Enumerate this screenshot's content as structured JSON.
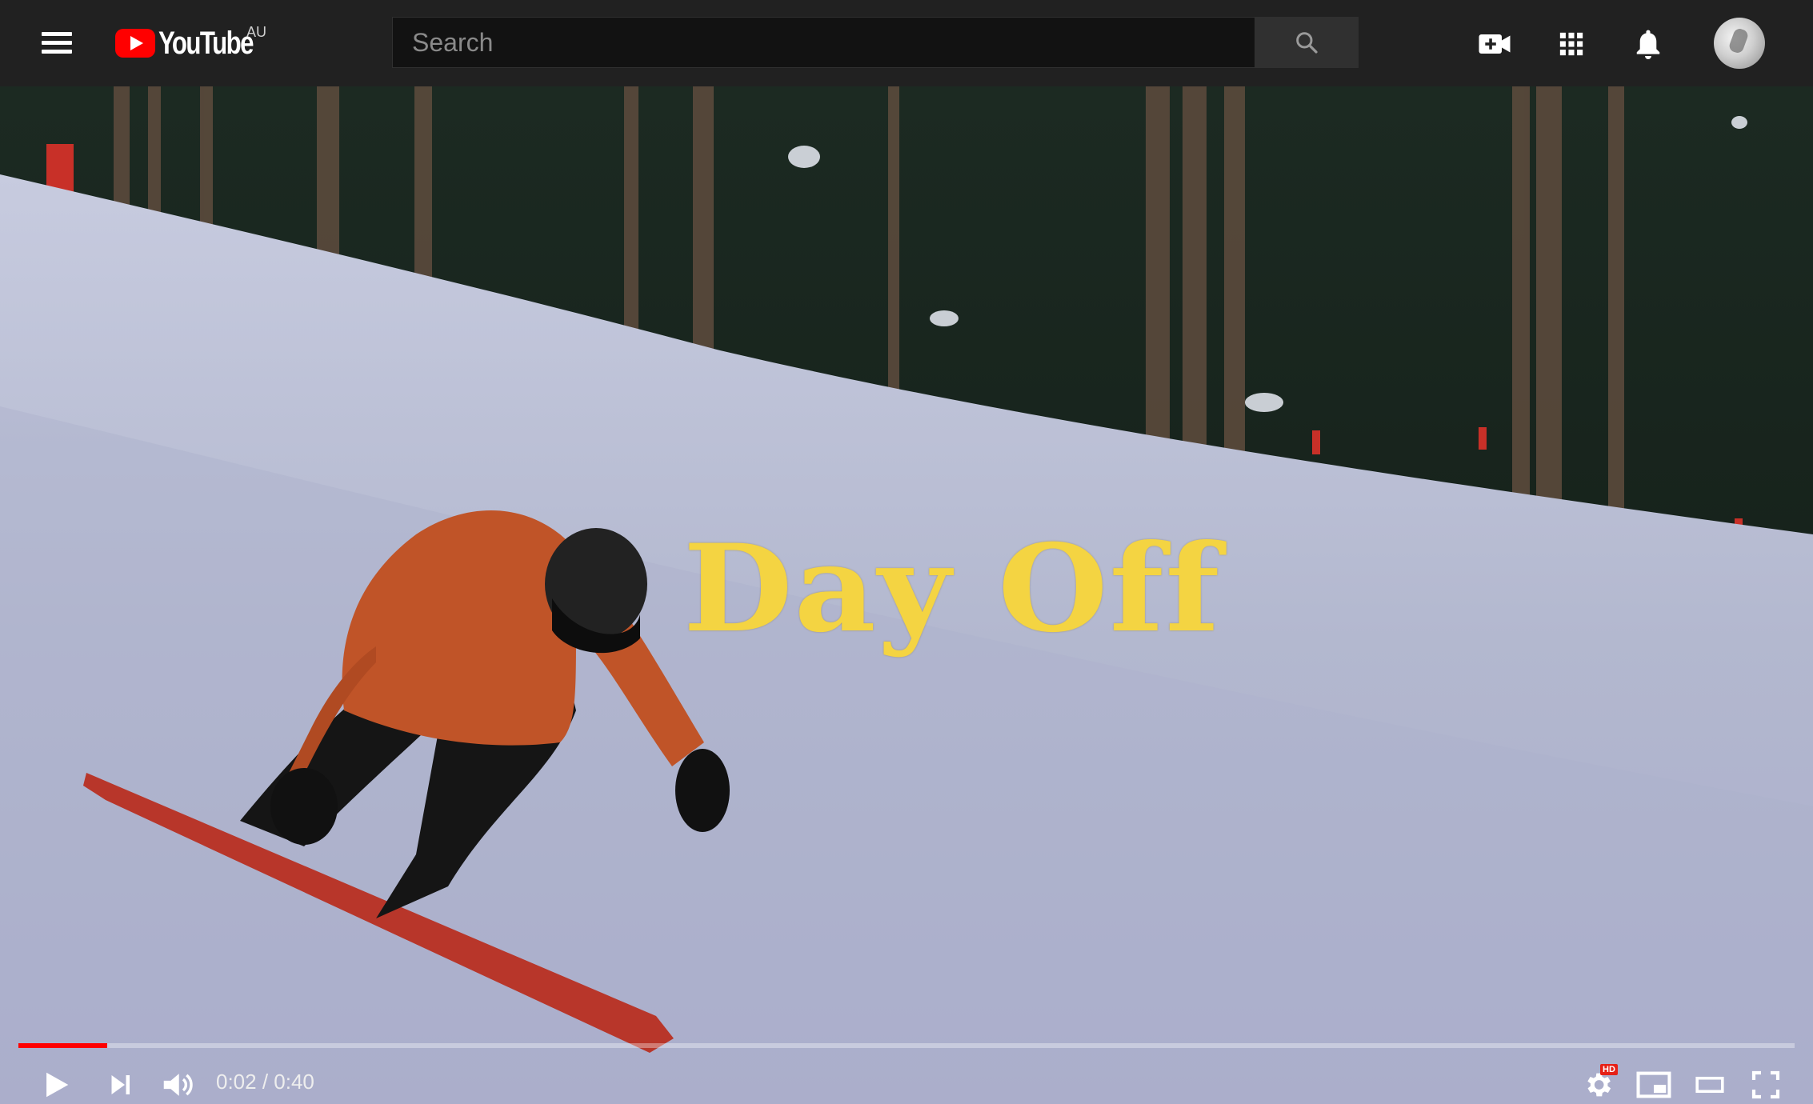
{
  "header": {
    "logo_text": "YouTube",
    "region": "AU",
    "search": {
      "placeholder": "Search",
      "value": ""
    },
    "icons": [
      "menu-icon",
      "search-icon",
      "create-video-icon",
      "apps-grid-icon",
      "notifications-bell-icon",
      "account-avatar"
    ]
  },
  "video": {
    "overlay_text": "Day Off",
    "progress": 0.05,
    "time": {
      "current": "0:02",
      "separator": " / ",
      "duration": "0:40"
    },
    "quality_badge": "HD"
  },
  "colors": {
    "topbar": "#212121",
    "accent_red": "#ff0000",
    "overlay_yellow": "#f4d442"
  }
}
